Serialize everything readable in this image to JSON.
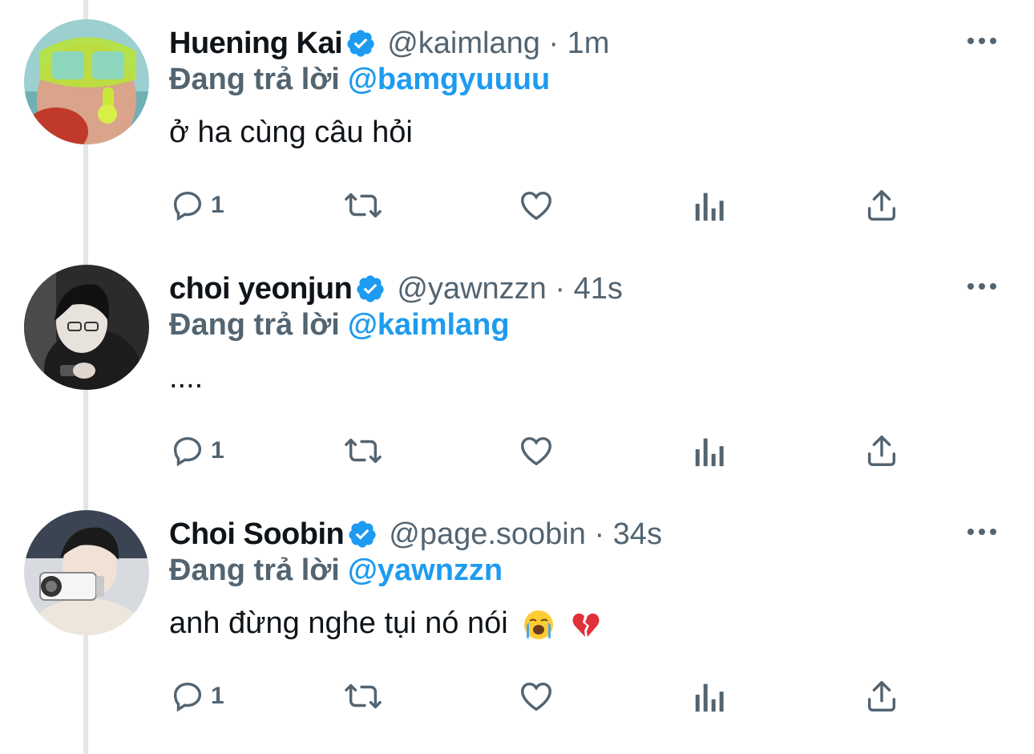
{
  "tweets": [
    {
      "name": "Huening Kai",
      "handle": "@kaimlang",
      "time": "1m",
      "reply_prefix": "Đang trả lời",
      "reply_to": "@bamgyuuuu",
      "text": "ở ha cùng câu hỏi",
      "reply_count": "1"
    },
    {
      "name": "choi yeonjun",
      "handle": "@yawnzzn",
      "time": "41s",
      "reply_prefix": "Đang trả lời",
      "reply_to": "@kaimlang",
      "text": "....",
      "reply_count": "1"
    },
    {
      "name": "Choi Soobin",
      "handle": "@page.soobin",
      "time": "34s",
      "reply_prefix": "Đang trả lời",
      "reply_to": "@yawnzzn",
      "text": "anh đừng nghe tụi nó nói",
      "reply_count": "1"
    }
  ],
  "separator": "·",
  "icons": [
    "verified-badge-icon",
    "more-options-icon",
    "reply-icon",
    "retweet-icon",
    "like-icon",
    "analytics-icon",
    "share-icon",
    "crying-face-emoji",
    "broken-heart-emoji"
  ],
  "colors": {
    "accent": "#1d9bf0",
    "secondary_text": "#536471",
    "thread_line": "#e6e6e6"
  }
}
